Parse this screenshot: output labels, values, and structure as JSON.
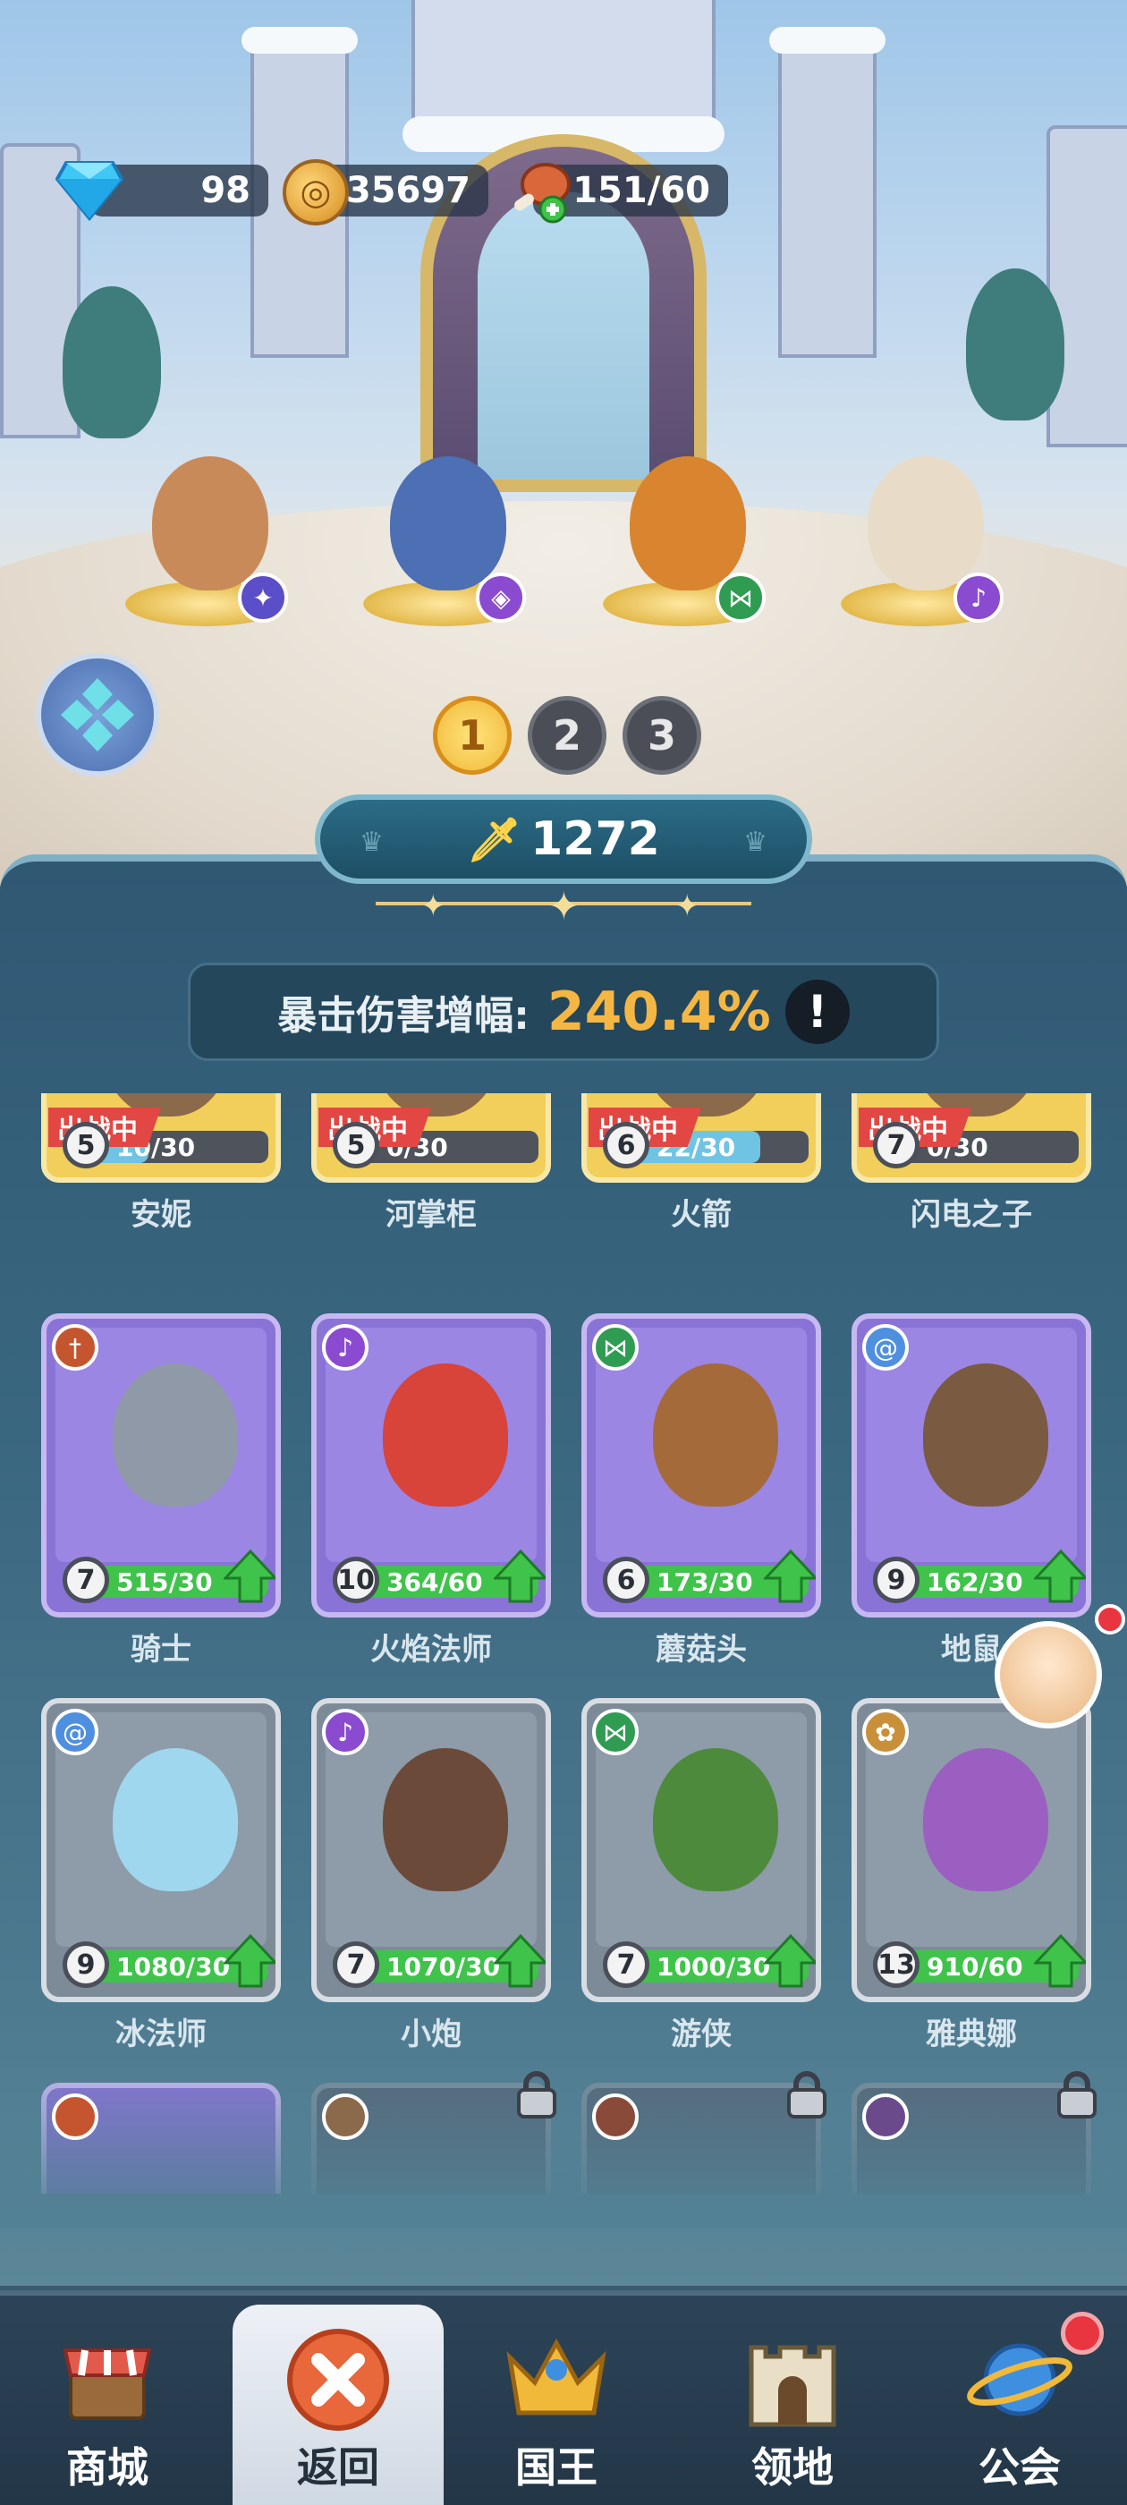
{
  "resources": {
    "gems": "98",
    "gold": "35697",
    "stamina": "151/60"
  },
  "party": {
    "heroes": [
      {
        "name": "安妮",
        "role_icon": "paw-icon",
        "color": "#c98a5a",
        "badge_color": "#5b4ec9"
      },
      {
        "name": "河掌柜",
        "role_icon": "diamond-eye-icon",
        "color": "#4d6fb4",
        "badge_color": "#8a4bd0"
      },
      {
        "name": "火箭",
        "role_icon": "network-icon",
        "color": "#d9852f",
        "badge_color": "#2f9c52"
      },
      {
        "name": "闪电之子",
        "role_icon": "staff-icon",
        "color": "#7f86a6",
        "badge_color": "#8a4bd0"
      }
    ],
    "pages": [
      "1",
      "2",
      "3"
    ],
    "active_page": "1"
  },
  "power": {
    "value": "1272"
  },
  "crit": {
    "label": "暴击伤害增幅:",
    "value": "240.4%",
    "info": "!"
  },
  "deployed_tag": "出战中",
  "deployed": [
    {
      "name": "安妮",
      "level": "5",
      "progress": "10/30",
      "fraction": 0.33
    },
    {
      "name": "河掌柜",
      "level": "5",
      "progress": "0/30",
      "fraction": 0.0
    },
    {
      "name": "火箭",
      "level": "6",
      "progress": "22/30",
      "fraction": 0.73
    },
    {
      "name": "闪电之子",
      "level": "7",
      "progress": "0/30",
      "fraction": 0.0
    }
  ],
  "heroes": [
    {
      "name": "骑士",
      "level": "7",
      "progress": "515/30",
      "rarity": "epic",
      "role_icon": "sword-icon",
      "role_color": "#c4552f",
      "char_color": "#8f99a8"
    },
    {
      "name": "火焰法师",
      "level": "10",
      "progress": "364/60",
      "rarity": "epic",
      "role_icon": "staff-icon",
      "role_color": "#8a4bd0",
      "char_color": "#d8433a"
    },
    {
      "name": "蘑菇头",
      "level": "6",
      "progress": "173/30",
      "rarity": "epic",
      "role_icon": "network-icon",
      "role_color": "#2f9c52",
      "char_color": "#a56a3a"
    },
    {
      "name": "地鼠",
      "level": "9",
      "progress": "162/30",
      "rarity": "epic",
      "role_icon": "spiral-icon",
      "role_color": "#4f8fe0",
      "char_color": "#7a5a40"
    },
    {
      "name": "冰法师",
      "level": "9",
      "progress": "1080/30",
      "rarity": "rare",
      "role_icon": "spiral-icon",
      "role_color": "#4f8fe0",
      "char_color": "#9fd7ef"
    },
    {
      "name": "小炮",
      "level": "7",
      "progress": "1070/30",
      "rarity": "rare",
      "role_icon": "staff-icon",
      "role_color": "#8a4bd0",
      "char_color": "#6b4a3a"
    },
    {
      "name": "游侠",
      "level": "7",
      "progress": "1000/30",
      "rarity": "rare",
      "role_icon": "network-icon",
      "role_color": "#2f9c52",
      "char_color": "#4d8a3c"
    },
    {
      "name": "雅典娜",
      "level": "13",
      "progress": "910/60",
      "rarity": "rare",
      "role_icon": "wings-icon",
      "role_color": "#c9903a",
      "char_color": "#9a5fc0"
    }
  ],
  "locked_row": [
    {
      "role_color": "#c4552f",
      "locked": false
    },
    {
      "role_color": "#8a6a4a",
      "locked": true
    },
    {
      "role_color": "#8a4a3a",
      "locked": true
    },
    {
      "role_color": "#6a4a8a",
      "locked": true
    }
  ],
  "nav": {
    "items": [
      {
        "label": "商城",
        "icon": "shop-icon"
      },
      {
        "label": "返回",
        "icon": "close-icon"
      },
      {
        "label": "国王",
        "icon": "crown-icon"
      },
      {
        "label": "领地",
        "icon": "castle-icon"
      },
      {
        "label": "公会",
        "icon": "planet-icon"
      }
    ],
    "active": "返回"
  },
  "colors": {
    "epic_card": "#8a73d6",
    "epic_border": "#c7b8f2",
    "rare_card": "#7d8b99",
    "deployed_card": "#f1cf5a",
    "upgrade_green": "#3fc34a"
  }
}
